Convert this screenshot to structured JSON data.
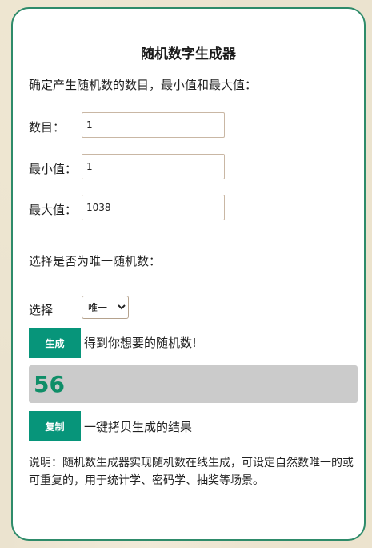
{
  "app": {
    "title": "随机数字生成器",
    "intro": "确定产生随机数的数目，最小值和最大值："
  },
  "fields": {
    "count_label": "数目：",
    "count_value": "1",
    "min_label": "最小值：",
    "min_value": "1",
    "max_label": "最大值：",
    "max_value": "1038"
  },
  "unique": {
    "prompt": "选择是否为唯一随机数：",
    "select_label": "选择",
    "selected_option": "唯一"
  },
  "generate": {
    "button_label": "生成",
    "hint": "得到你想要的随机数!"
  },
  "result": {
    "value": "56"
  },
  "copy": {
    "button_label": "复制",
    "hint": "一键拷贝生成的结果"
  },
  "description": "说明：随机数生成器实现随机数在线生成，可设定自然数唯一的或可重复的，用于统计学、密码学、抽奖等场景。",
  "colors": {
    "accent": "#07957a",
    "border": "#2e8b6a",
    "result_text": "#0f8e68",
    "result_bg": "#cbcbcb"
  }
}
